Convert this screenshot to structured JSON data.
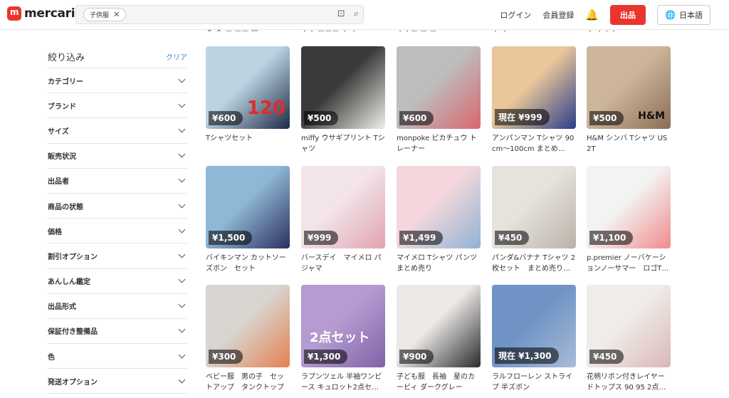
{
  "header": {
    "logo_text": "mercari",
    "search_chip": "子供服",
    "login": "ログイン",
    "signup": "会員登録",
    "sell": "出品",
    "language": "日本語"
  },
  "sidebar": {
    "title": "絞り込み",
    "clear": "クリア",
    "filters": [
      "カテゴリー",
      "ブランド",
      "サイズ",
      "販売状況",
      "出品者",
      "商品の状態",
      "価格",
      "割引オプション",
      "あんしん鑑定",
      "出品形式",
      "保証付き整備品",
      "色",
      "発送オプション"
    ]
  },
  "items": [
    {
      "price": "¥600",
      "name": "Tシャツセット",
      "overlay": "120",
      "colors": [
        "#bcd3e2",
        "#1c2a45"
      ]
    },
    {
      "price": "¥500",
      "name": "miffy ウサギプリント Tシャツ",
      "colors": [
        "#3a3a3a",
        "#f2f0ea"
      ]
    },
    {
      "price": "¥600",
      "name": "monpoke ピカチュウ トレーナー",
      "colors": [
        "#bdbdbd",
        "#d8676d"
      ]
    },
    {
      "price": "現在 ¥999",
      "name": "アンパンマン Tシャツ 90cm〜100cm まとめ…",
      "colors": [
        "#e9c79a",
        "#2b3d8a"
      ]
    },
    {
      "price": "¥500",
      "name": "H&M シンバ Tシャツ US 2T",
      "overlay": "H&M",
      "colors": [
        "#cdb59a",
        "#8a6e55"
      ]
    },
    {
      "price": "¥1,500",
      "name": "バイキンマン カットソー ズボン　セット",
      "colors": [
        "#8fb8d6",
        "#2d2f5e"
      ]
    },
    {
      "price": "¥999",
      "name": "バースデイ　マイメロ パジャマ",
      "colors": [
        "#f2e4e8",
        "#e0a3b1"
      ]
    },
    {
      "price": "¥1,499",
      "name": "マイメロ Tシャツ パンツ まとめ売り",
      "colors": [
        "#f4d7dd",
        "#8fb3d3"
      ]
    },
    {
      "price": "¥450",
      "name": "パンダ&バナナ Tシャツ 2枚セット　まとめ売り…",
      "colors": [
        "#e6e2dc",
        "#b9b2a8"
      ]
    },
    {
      "price": "¥1,100",
      "name": "p.premier ノーバケーションノーサマー　ロゴT…",
      "colors": [
        "#f3f3f3",
        "#f08b8b"
      ]
    },
    {
      "price": "¥300",
      "name": "ベビー服　男の子　セットアップ　タンクトップ",
      "colors": [
        "#d8d5d0",
        "#e48050"
      ]
    },
    {
      "price": "¥1,300",
      "name": "ラプンツェル 半袖ワンピース キュロット2点セ…",
      "overlay": "2点セット",
      "colors": [
        "#b59bd1",
        "#7f63a6"
      ]
    },
    {
      "price": "¥900",
      "name": "子ども服　長袖　星のカービィ ダークグレー",
      "colors": [
        "#ece9e6",
        "#2a2a2e"
      ]
    },
    {
      "price": "現在 ¥1,300",
      "name": "ラルフローレン ストライプ 半ズボン",
      "colors": [
        "#6f93c4",
        "#a8bcd8"
      ]
    },
    {
      "price": "¥450",
      "name": "花柄リボン付きレイヤードトップス 90 95 2点…",
      "colors": [
        "#f0ece8",
        "#d9b7b8"
      ]
    }
  ],
  "top_partial": [
    "ヘ ヘ ー ーー 皿",
    "・・ ーーー ・ ・",
    "・・ー ー ー",
    "・ ・",
    "・ ・・・"
  ]
}
